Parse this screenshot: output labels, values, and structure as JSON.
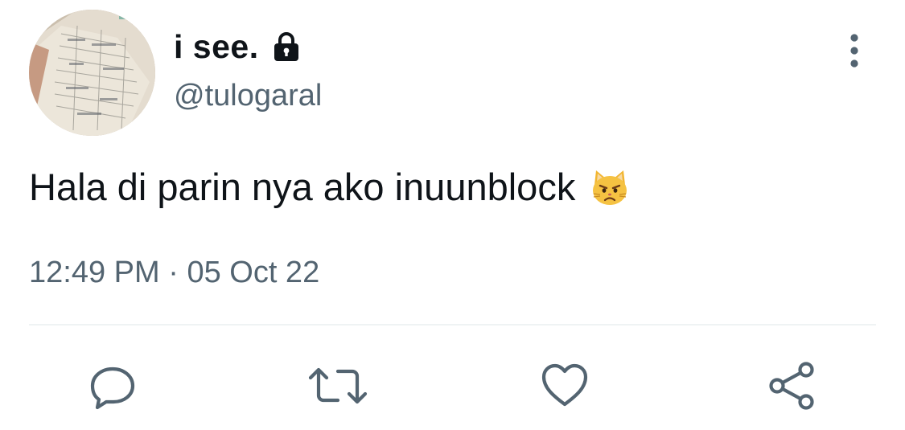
{
  "user": {
    "display_name": "i see.",
    "handle": "@tulogaral",
    "protected_icon": "lock-icon",
    "avatar_icon": "avatar-notes-photo"
  },
  "tweet": {
    "text": "Hala di parin nya ako inuunblock",
    "emoji": "pouting-cat-emoji",
    "time": "12:49 PM",
    "separator": "·",
    "date": "05 Oct 22"
  },
  "actions": {
    "reply": "reply-icon",
    "retweet": "retweet-icon",
    "like": "heart-icon",
    "share": "share-icon",
    "more": "more-vertical-icon"
  },
  "colors": {
    "text_primary": "#0f1419",
    "text_secondary": "#536471",
    "icon": "#536471",
    "divider": "#eff3f4"
  }
}
